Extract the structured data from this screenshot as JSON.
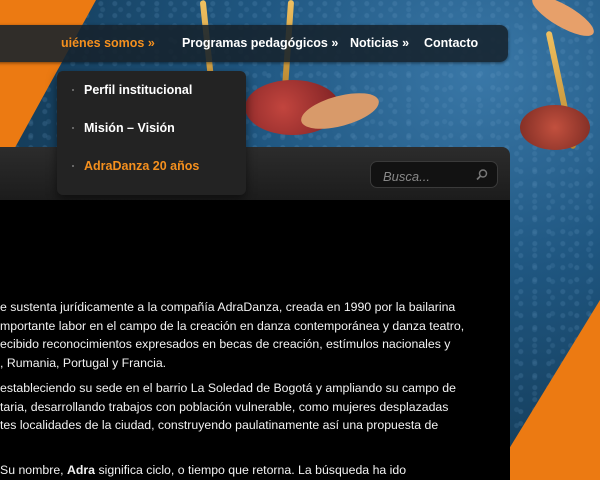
{
  "nav": {
    "items": [
      {
        "label": "uiénes somos »"
      },
      {
        "label": "Programas pedagógicos »"
      },
      {
        "label": "Noticias »"
      },
      {
        "label": "Contacto"
      }
    ],
    "dropdown": [
      {
        "label": "Perfil institucional"
      },
      {
        "label": "Misión – Visión"
      },
      {
        "label": "AdraDanza 20 años"
      }
    ]
  },
  "search": {
    "placeholder": "Busca..."
  },
  "content": {
    "para1": [
      "e sustenta jurídicamente    a la compañía AdraDanza, creada en  1990 por la bailarina",
      "mportante labor en el  campo de la  creación en danza contemporánea y  danza teatro,",
      "ecibido reconocimientos expresados en becas de creación, estímulos nacionales y",
      ", Rumania, Portugal y Francia."
    ],
    "para2": [
      "estableciendo su sede en el barrio La Soledad de Bogotá y ampliando su campo de",
      "taria, desarrollando trabajos con población vulnerable, como mujeres desplazadas",
      "tes localidades de la ciudad, construyendo paulatinamente así una propuesta de"
    ],
    "para3_pre": "Su nombre, ",
    "para3_bold": "Adra",
    "para3_post": " significa ciclo, o tiempo que retorna. La búsqueda ha ido"
  },
  "colors": {
    "accent": "#f5901e",
    "orange_shape": "#ec7a12",
    "nav_bg": "#16222c"
  }
}
